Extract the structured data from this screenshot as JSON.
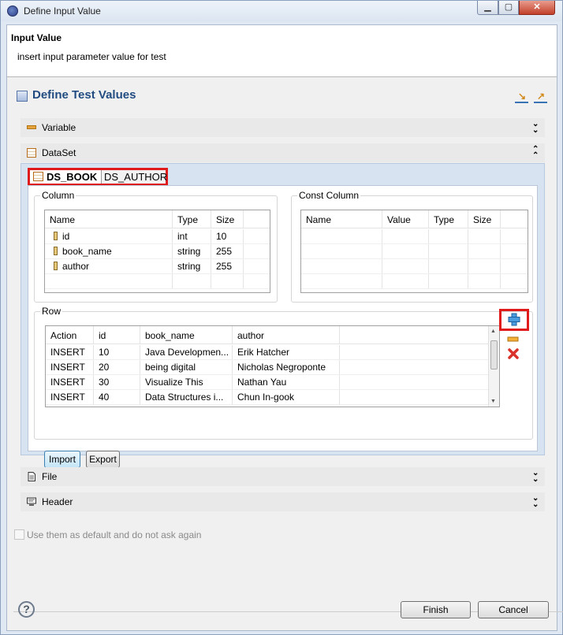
{
  "window": {
    "title": "Define Input Value"
  },
  "header": {
    "title": "Input Value",
    "description": "insert input parameter value for test"
  },
  "form": {
    "title": "Define Test Values"
  },
  "sections": {
    "variable": "Variable",
    "dataset": "DataSet",
    "file": "File",
    "header": "Header"
  },
  "dataset_tabs": [
    "DS_BOOK",
    "DS_AUTHOR"
  ],
  "column_group": {
    "label": "Column",
    "headers": [
      "Name",
      "Type",
      "Size"
    ],
    "rows": [
      [
        "id",
        "int",
        "10"
      ],
      [
        "book_name",
        "string",
        "255"
      ],
      [
        "author",
        "string",
        "255"
      ]
    ]
  },
  "const_group": {
    "label": "Const Column",
    "headers": [
      "Name",
      "Value",
      "Type",
      "Size"
    ]
  },
  "row_group": {
    "label": "Row",
    "headers": [
      "Action",
      "id",
      "book_name",
      "author"
    ],
    "rows": [
      [
        "INSERT",
        "10",
        "Java Developmen...",
        "Erik Hatcher"
      ],
      [
        "INSERT",
        "20",
        "being digital",
        "Nicholas Negroponte"
      ],
      [
        "INSERT",
        "30",
        "Visualize This",
        "Nathan Yau"
      ],
      [
        "INSERT",
        "40",
        "Data Structures i...",
        "Chun In-gook"
      ]
    ]
  },
  "buttons": {
    "import": "Import",
    "export": "Export",
    "finish": "Finish",
    "cancel": "Cancel"
  },
  "default_checkbox": {
    "label": "Use them as default and do not ask again",
    "checked": false
  },
  "colors": {
    "highlight": "#e01b1b",
    "form_title": "#224c81",
    "section_bg": "#e9e9e9"
  }
}
